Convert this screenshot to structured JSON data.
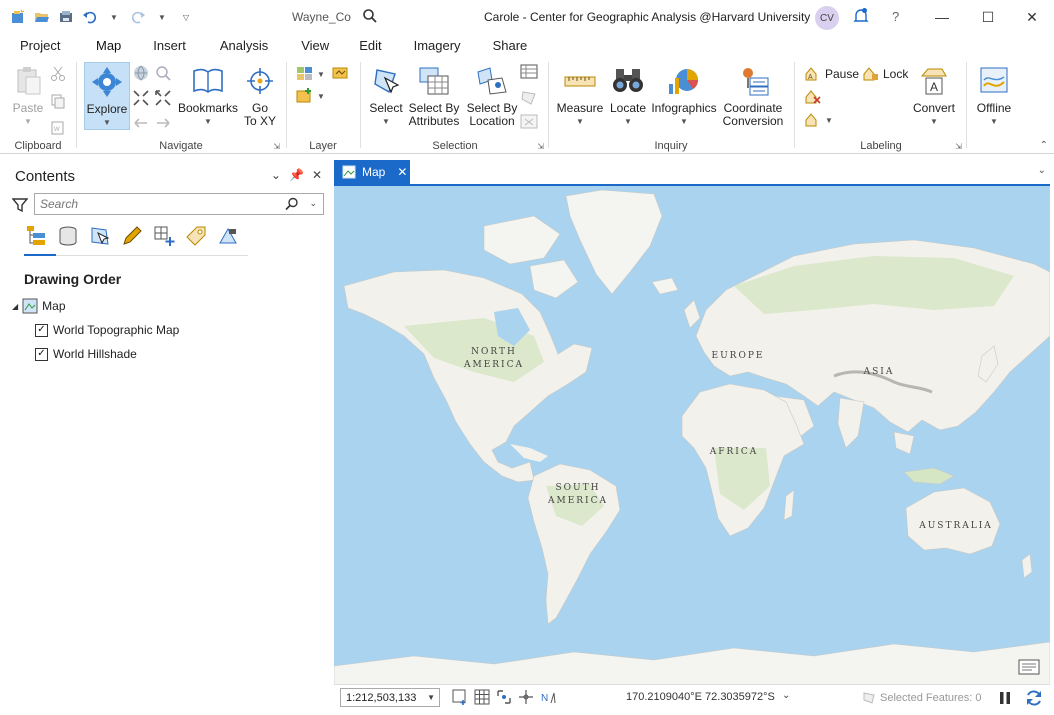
{
  "titlebar": {
    "project_name": "Wayne_Co",
    "window_title": "Carole - Center for Geographic Analysis @Harvard University",
    "avatar_initials": "CV",
    "help": "?"
  },
  "tabs": [
    "Project",
    "Map",
    "Insert",
    "Analysis",
    "View",
    "Edit",
    "Imagery",
    "Share"
  ],
  "active_tab": "Map",
  "ribbon": {
    "clipboard": {
      "label": "Clipboard",
      "paste": "Paste"
    },
    "navigate": {
      "label": "Navigate",
      "explore": "Explore",
      "bookmarks": "Bookmarks",
      "goto_1": "Go",
      "goto_2": "To XY"
    },
    "layer": {
      "label": "Layer"
    },
    "selection": {
      "label": "Selection",
      "select": "Select",
      "by_attr_1": "Select By",
      "by_attr_2": "Attributes",
      "by_loc_1": "Select By",
      "by_loc_2": "Location"
    },
    "inquiry": {
      "label": "Inquiry",
      "measure": "Measure",
      "locate": "Locate",
      "infographics": "Infographics",
      "coord_1": "Coordinate",
      "coord_2": "Conversion"
    },
    "labeling": {
      "label": "Labeling",
      "pause": "Pause",
      "lock": "Lock",
      "convert": "Convert"
    },
    "offline": {
      "label": "Offline"
    }
  },
  "contents": {
    "title": "Contents",
    "search_placeholder": "Search",
    "section": "Drawing Order",
    "map_name": "Map",
    "layers": [
      {
        "name": "World Topographic Map",
        "checked": true
      },
      {
        "name": "World Hillshade",
        "checked": true
      }
    ]
  },
  "mapview": {
    "tab_label": "Map",
    "labels": {
      "north_america_1": "NORTH",
      "north_america_2": "AMERICA",
      "south_america_1": "SOUTH",
      "south_america_2": "AMERICA",
      "europe": "EUROPE",
      "asia": "ASIA",
      "africa": "AFRICA",
      "australia": "AUSTRALIA"
    }
  },
  "statusbar": {
    "scale": "1:212,503,133",
    "coordinates": "170.2109040°E 72.3035972°S",
    "selected_features": "Selected Features: 0"
  },
  "colors": {
    "accent": "#1b6ac9",
    "ocean": "#a9d3ef",
    "land": "#f3f1ec",
    "vegetation": "#d4e6c3"
  }
}
